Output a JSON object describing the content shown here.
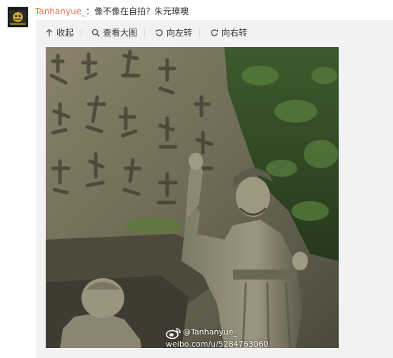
{
  "post": {
    "username": "Tanhanyue_",
    "caption": "：像不像在自拍？朱元璋噢"
  },
  "toolbar": {
    "items": [
      {
        "icon": "arrow-up-icon",
        "label": "收起"
      },
      {
        "icon": "magnifier-icon",
        "label": "查看大图"
      },
      {
        "icon": "rotate-left-icon",
        "label": "向左转"
      },
      {
        "icon": "rotate-right-icon",
        "label": "向右转"
      }
    ]
  },
  "image": {
    "watermark_handle": "@Tanhanyue_",
    "watermark_url": "weibo.com/u/5284763060"
  },
  "colors": {
    "username": "#eb7350",
    "card_background": "#f2f2f5",
    "text": "#333333"
  }
}
